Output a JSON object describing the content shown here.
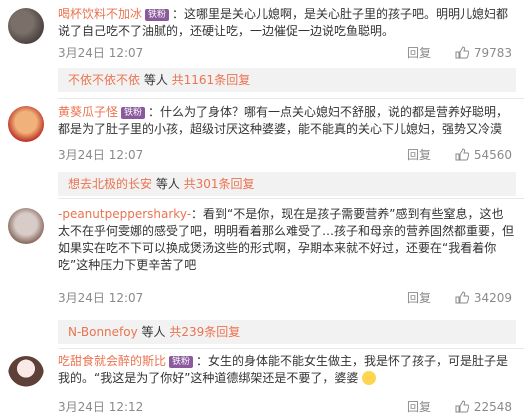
{
  "comments": [
    {
      "user": "喝杯饮料不加冰",
      "badge": "铁粉",
      "text": "：这哪里是关心儿媳啊，是关心肚子里的孩子吧。明明儿媳妇都说了自己吃不了油腻的，还硬让吃，一边催促一边说吃鱼聪明。",
      "date": "3月24日 12:07",
      "reply_label": "回复",
      "likes": "79783",
      "sub_name": "不依不依不依",
      "sub_text": " 等人 ",
      "sub_count": "共1161条回复"
    },
    {
      "user": "黄葵瓜子怪",
      "badge": "铁粉",
      "text": "：什么为了身体？哪有一点关心媳妇不舒服，说的都是营养好聪明，都是为了肚子里的小孩，超级讨厌这种婆婆，能不能真的关心下儿媳妇，强势又冷漠",
      "date": "3月24日 12:07",
      "reply_label": "回复",
      "likes": "54560",
      "sub_name": "想去北极的长安",
      "sub_text": " 等人 ",
      "sub_count": "共301条回复"
    },
    {
      "user": "-peanutpeppersharky-",
      "badge": "",
      "text": "：看到“不是你，现在是孩子需要营养”感到有些窒息，这也太不在乎何雯娜的感受了吧，明明看着那么难受了…孩子和母亲的营养固然都重要，但如果实在吃不下可以换成煲汤这些的形式啊，孕期本来就不好过，还要在“我看着你吃”这种压力下更辛苦了吧",
      "date": "3月24日 12:07",
      "reply_label": "回复",
      "likes": "34209",
      "sub_name": "N-Bonnefoy",
      "sub_text": " 等人 ",
      "sub_count": "共239条回复"
    },
    {
      "user": "吃甜食就会醉的斯比",
      "badge": "铁粉",
      "text": "：女生的身体能不能女生做主，我是怀了孩子，可是肚子是我的。“我这是为了你好”这种道德绑架还是不要了，婆婆",
      "date": "3月24日 12:12",
      "reply_label": "回复",
      "likes": "22548"
    }
  ],
  "colors": {
    "username": "#eb7350",
    "subbg": "#f2f2f2"
  }
}
